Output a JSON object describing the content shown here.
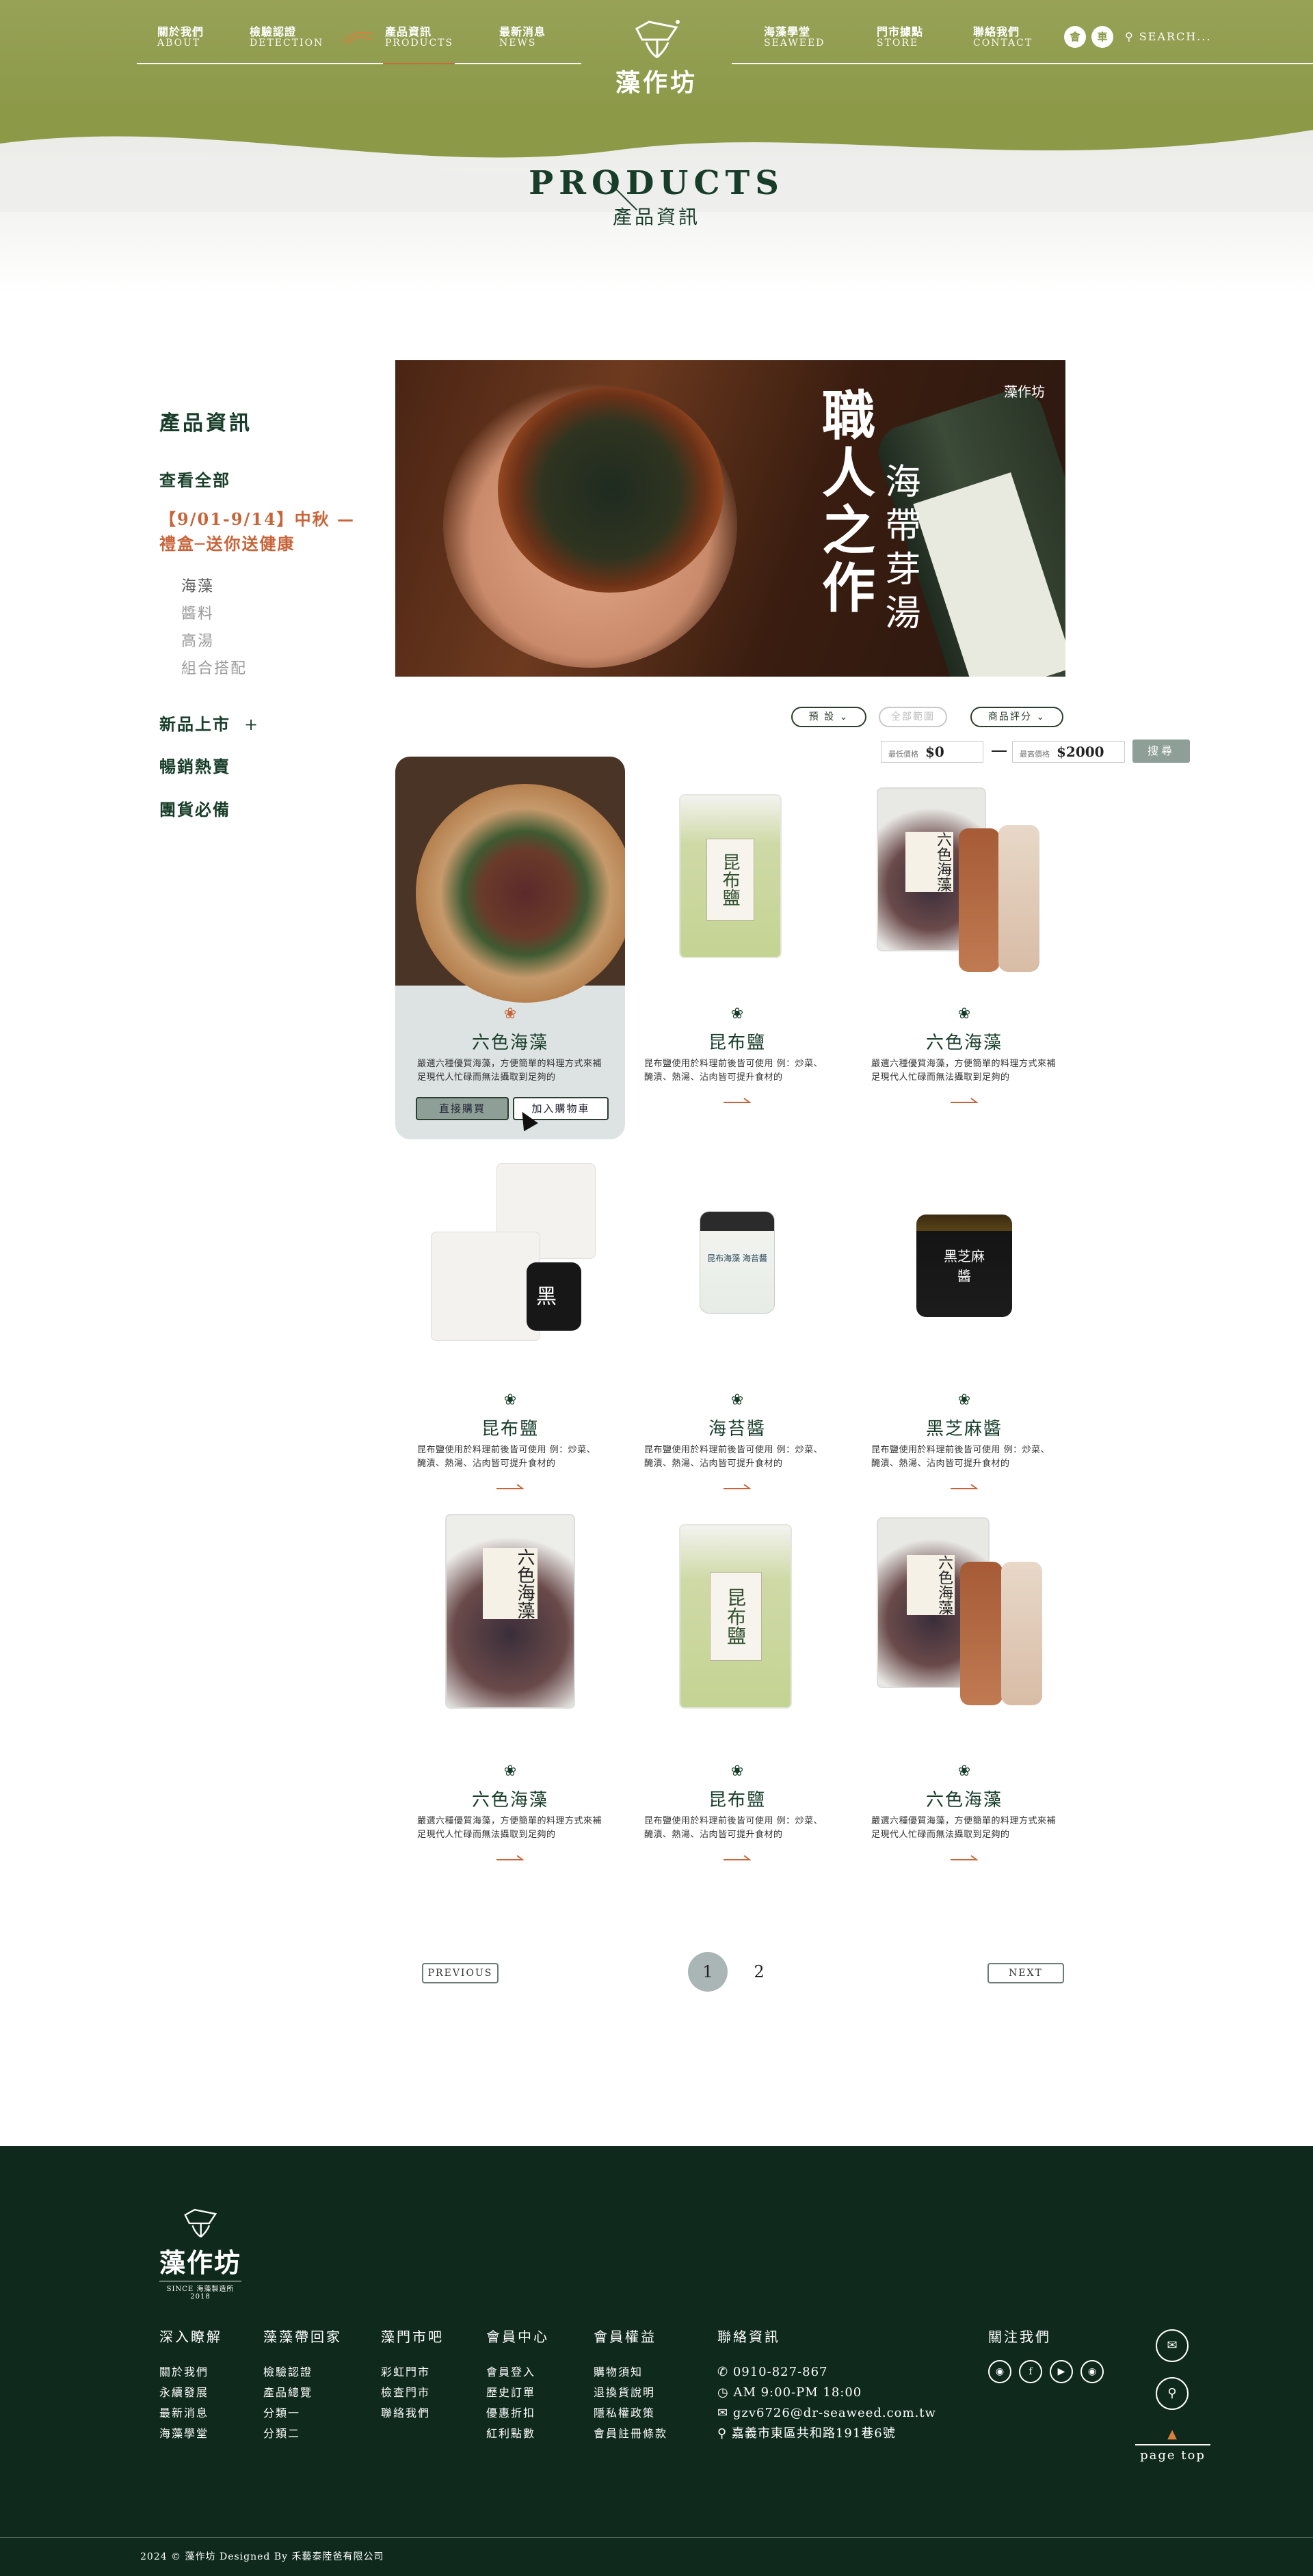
{
  "header": {
    "nav_left": [
      {
        "zh": "關於我們",
        "en": "ABOUT"
      },
      {
        "zh": "檢驗認證",
        "en": "DETECTION"
      },
      {
        "zh": "產品資訊",
        "en": "PRODUCTS"
      },
      {
        "zh": "最新消息",
        "en": "NEWS"
      }
    ],
    "nav_right": [
      {
        "zh": "海藻學堂",
        "en": "SEAWEED"
      },
      {
        "zh": "門市據點",
        "en": "STORE"
      },
      {
        "zh": "聯絡我們",
        "en": "CONTACT"
      }
    ],
    "logo_name": "藻作坊",
    "member_icon_text": "會",
    "cart_icon_text": "車",
    "search_label": "SEARCH..."
  },
  "page_title": {
    "en": "PRODUCTS",
    "zh": "產品資訊"
  },
  "sidebar": {
    "title": "產品資訊",
    "view_all": "查看全部",
    "promo": "【9/01-9/14】中秋 — 禮盒─送你送健康",
    "sub_items": [
      "海藻",
      "醬料",
      "高湯",
      "組合搭配"
    ],
    "new": "新品上市",
    "new_plus": "+",
    "best": "暢銷熱賣",
    "group": "團貨必備"
  },
  "banner": {
    "title1": "職人之作",
    "title2": "海帶芽湯",
    "logo": "藻作坊"
  },
  "filters": {
    "sort": "預 設",
    "range": "全部範圍",
    "rating": "商品評分",
    "min_label": "最低價格",
    "min_value": "$0",
    "max_label": "最高價格",
    "max_value": "$2000",
    "search_button": "搜尋"
  },
  "products": [
    {
      "name": "六色海藻",
      "desc": "嚴選六種優質海藻，方便簡單的料理方式來補足現代人忙碌而無法攝取到足夠的",
      "buy": "直接購買",
      "cart": "加入購物車"
    },
    {
      "name": "昆布鹽",
      "desc": "昆布鹽使用於料理前後皆可使用 例：炒菜、醃漬、熱湯、沾肉皆可提升食材的"
    },
    {
      "name": "六色海藻",
      "desc": "嚴選六種優質海藻，方便簡單的料理方式來補足現代人忙碌而無法攝取到足夠的"
    },
    {
      "name": "昆布鹽",
      "desc": "昆布鹽使用於料理前後皆可使用 例：炒菜、醃漬、熱湯、沾肉皆可提升食材的"
    },
    {
      "name": "海苔醬",
      "desc": "昆布鹽使用於料理前後皆可使用 例：炒菜、醃漬、熱湯、沾肉皆可提升食材的"
    },
    {
      "name": "黑芝麻醬",
      "desc": "昆布鹽使用於料理前後皆可使用 例：炒菜、醃漬、熱湯、沾肉皆可提升食材的"
    },
    {
      "name": "六色海藻",
      "desc": "嚴選六種優質海藻，方便簡單的料理方式來補足現代人忙碌而無法攝取到足夠的"
    },
    {
      "name": "昆布鹽",
      "desc": "昆布鹽使用於料理前後皆可使用 例：炒菜、醃漬、熱湯、沾肉皆可提升食材的"
    },
    {
      "name": "六色海藻",
      "desc": "嚴選六種優質海藻，方便簡單的料理方式來補足現代人忙碌而無法攝取到足夠的"
    }
  ],
  "product_labels": {
    "bag_six": "六色海藻",
    "bag_salt": "昆布鹽",
    "black": "黑",
    "nori_jar": "昆布海藻 海苔醬",
    "sesame_jar": "黑芝麻醬"
  },
  "pagination": {
    "prev": "PREVIOUS",
    "next": "NEXT",
    "pages": [
      "1",
      "2"
    ],
    "current": "1"
  },
  "footer": {
    "logo_name": "藻作坊",
    "logo_tag": "SINCE 海藻製造所 2018",
    "columns": [
      {
        "title": "深入瞭解",
        "items": [
          "關於我們",
          "永續發展",
          "最新消息",
          "海藻學堂"
        ]
      },
      {
        "title": "藻藻帶回家",
        "items": [
          "檢驗認證",
          "產品總覽",
          "分類一",
          "分類二"
        ]
      },
      {
        "title": "藻門市吧",
        "items": [
          "彩虹門市",
          "檢查門市",
          "聯絡我們"
        ]
      },
      {
        "title": "會員中心",
        "items": [
          "會員登入",
          "歷史訂單",
          "優惠折扣",
          "紅利點數"
        ]
      },
      {
        "title": "會員權益",
        "items": [
          "購物須知",
          "退換貨說明",
          "隱私權政策",
          "會員註冊條款"
        ]
      }
    ],
    "contact": {
      "title": "聯絡資訊",
      "phone": "0910-827-867",
      "hours": "AM 9:00-PM 18:00",
      "email": "gzv6726@dr-seaweed.com.tw",
      "address": "嘉義市東區共和路191巷6號"
    },
    "follow_title": "關注我們",
    "page_top": "page top",
    "copyright": "2024 © 藻作坊 Designed By 禾藝泰陸爸有限公司"
  },
  "colors": {
    "header_green": "#8c9a47",
    "dark_green": "#173d2a",
    "accent_orange": "#c8643a",
    "footer_bg": "#0f2a1d",
    "grey_button": "#8d9f97"
  }
}
